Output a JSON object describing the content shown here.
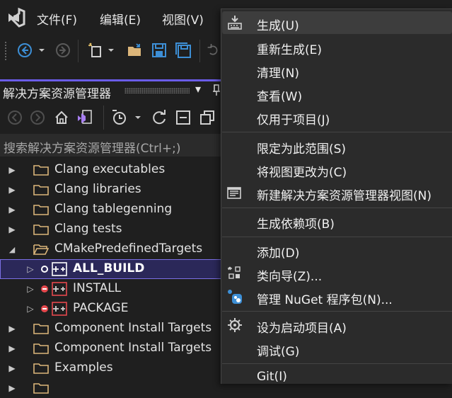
{
  "menubar": {
    "items": [
      "文件(F)",
      "编辑(E)",
      "视图(V)"
    ]
  },
  "solution_explorer": {
    "title": "解决方案资源管理器",
    "pin_glyph": "▾",
    "search_placeholder": "搜索解决方案资源管理器(Ctrl+;)",
    "tree": [
      {
        "label": "Clang executables",
        "kind": "folder",
        "expanded": false
      },
      {
        "label": "Clang libraries",
        "kind": "folder",
        "expanded": false
      },
      {
        "label": "Clang tablegenning",
        "kind": "folder",
        "expanded": false
      },
      {
        "label": "Clang tests",
        "kind": "folder",
        "expanded": false
      },
      {
        "label": "CMakePredefinedTargets",
        "kind": "folder-open",
        "expanded": true
      },
      {
        "label": "ALL_BUILD",
        "kind": "project",
        "selected": true
      },
      {
        "label": "INSTALL",
        "kind": "project"
      },
      {
        "label": "PACKAGE",
        "kind": "project"
      },
      {
        "label": "Component Install Targets",
        "kind": "folder",
        "expanded": false
      },
      {
        "label": "Component Install Targets",
        "kind": "folder",
        "expanded": false
      },
      {
        "label": "Examples",
        "kind": "folder",
        "expanded": false
      }
    ]
  },
  "context_menu": {
    "items": [
      {
        "label": "生成(U)",
        "icon": "build-icon",
        "highlighted": true
      },
      {
        "label": "重新生成(E)"
      },
      {
        "label": "清理(N)"
      },
      {
        "label": "查看(W)"
      },
      {
        "label": "仅用于项目(J)"
      },
      {
        "label": "限定为此范围(S)"
      },
      {
        "label": "将视图更改为(C)"
      },
      {
        "label": "新建解决方案资源管理器视图(N)",
        "icon": "new-view-icon"
      },
      {
        "label": "生成依赖项(B)"
      },
      {
        "label": "添加(D)"
      },
      {
        "label": "类向导(Z)...",
        "icon": "class-wizard-icon"
      },
      {
        "label": "管理 NuGet 程序包(N)...",
        "icon": "nuget-icon"
      },
      {
        "label": "设为启动项目(A)",
        "icon": "gear-icon"
      },
      {
        "label": "调试(G)"
      },
      {
        "label": "Git(I)"
      }
    ]
  },
  "colors": {
    "accent": "#6a5ce8",
    "selection": "#2b2859",
    "menu_bg": "#2b2b2b",
    "folder": "#dcb67a",
    "blue_icon": "#3d8fd6"
  }
}
